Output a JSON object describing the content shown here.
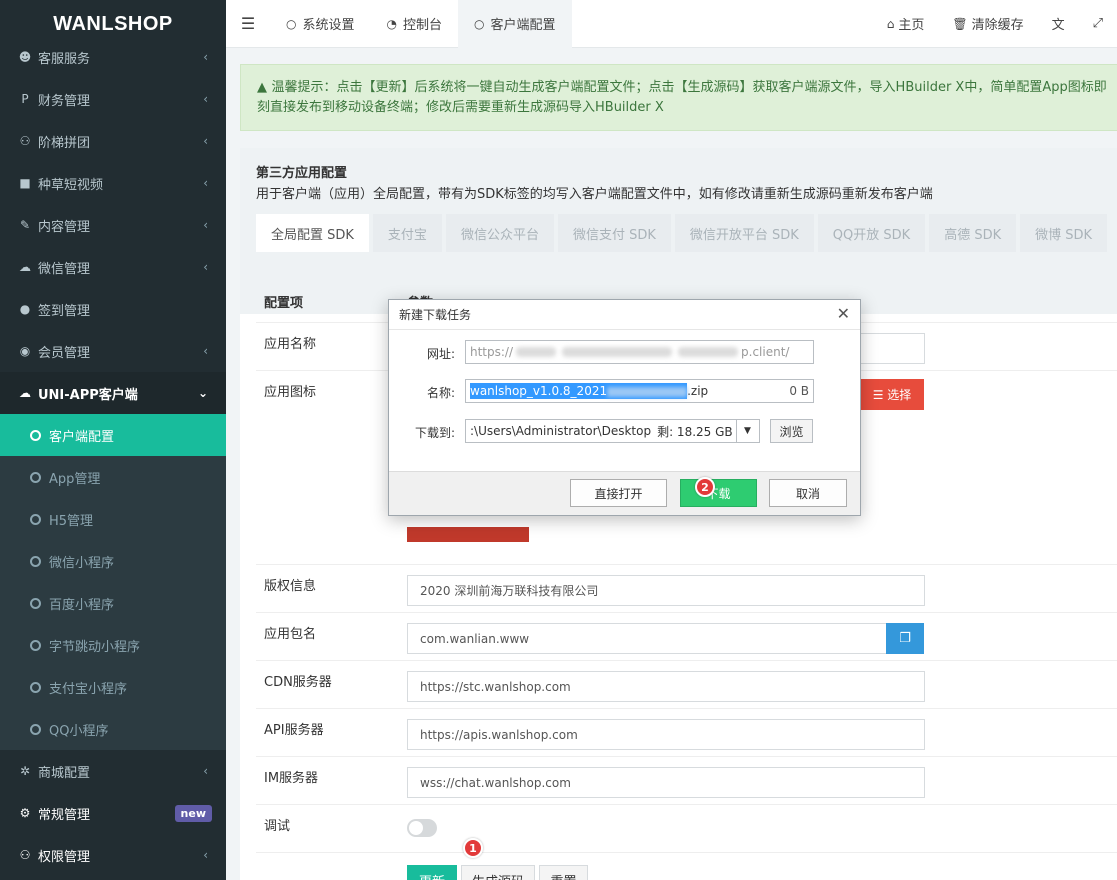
{
  "brand": "WANLSHOP",
  "sidebar": {
    "items": [
      {
        "label": "客服服务",
        "icon": "comments-icon",
        "glyph": "☻"
      },
      {
        "label": "财务管理",
        "icon": "paypal-icon",
        "glyph": "P"
      },
      {
        "label": "阶梯拼团",
        "icon": "users-icon",
        "glyph": "👥"
      },
      {
        "label": "种草短视频",
        "icon": "video-icon",
        "glyph": "■"
      },
      {
        "label": "内容管理",
        "icon": "edit-icon",
        "glyph": "✎"
      },
      {
        "label": "微信管理",
        "icon": "wechat-icon",
        "glyph": "☁"
      },
      {
        "label": "签到管理",
        "icon": "map-marker-icon",
        "glyph": "●"
      },
      {
        "label": "会员管理",
        "icon": "user-circle-icon",
        "glyph": "◉"
      }
    ],
    "open_group": {
      "label": "UNI-APP客户端",
      "icon": "cloud-icon",
      "glyph": "☁"
    },
    "sub_items": [
      "客户端配置",
      "App管理",
      "H5管理",
      "微信小程序",
      "百度小程序",
      "字节跳动小程序",
      "支付宝小程序",
      "QQ小程序"
    ],
    "after": [
      {
        "label": "商城配置",
        "icon": "gear-icon",
        "glyph": "✲"
      },
      {
        "label": "常规管理",
        "icon": "cogs-icon",
        "glyph": "⚙",
        "badge": "new"
      },
      {
        "label": "权限管理",
        "icon": "group-icon",
        "glyph": "👥"
      }
    ]
  },
  "header": {
    "tabs": [
      "系统设置",
      "控制台",
      "客户端配置"
    ],
    "home": "主页",
    "clear_cache": "清除缓存"
  },
  "alert": {
    "title": "温馨提示：",
    "text": "点击【更新】后系统将一键自动生成客户端配置文件；点击【生成源码】获取客户端源文件，导入HBuilder X中，简单配置App图标即刻直接发布到移动设备终端；修改后需要重新生成源码导入HBuilder X"
  },
  "panel": {
    "title": "第三方应用配置",
    "desc": "用于客户端（应用）全局配置，带有为SDK标签的均写入客户端配置文件中，如有修改请重新生成源码重新发布客户端",
    "tabs": [
      "全局配置 SDK",
      "支付宝",
      "微信公众平台",
      "微信支付 SDK",
      "微信开放平台 SDK",
      "QQ开放 SDK",
      "高德 SDK",
      "微博 SDK"
    ]
  },
  "table": {
    "col_item": "配置项",
    "col_param": "参数",
    "rows": {
      "app_name": "应用名称",
      "app_icon": "应用图标",
      "choose": "选择",
      "copyright": "版权信息",
      "copyright_val": "2020 深圳前海万联科技有限公司",
      "package": "应用包名",
      "package_val": "com.wanlian.www",
      "cdn": "CDN服务器",
      "cdn_val": "https://stc.wanlshop.com",
      "api": "API服务器",
      "api_val": "https://apis.wanlshop.com",
      "im": "IM服务器",
      "im_val": "wss://chat.wanlshop.com",
      "debug": "调试"
    },
    "buttons": {
      "update": "更新",
      "generate": "生成源码",
      "reset": "重置"
    }
  },
  "dialog": {
    "title": "新建下载任务",
    "url_label": "网址:",
    "url_start": "https://",
    "url_end": "p.client/",
    "name_label": "名称:",
    "name_start": "wanlshop_v1.0.8_2021",
    "name_end": ".zip",
    "size": "0 B",
    "save_label": "下载到:",
    "save_path": ":\\Users\\Administrator\\Desktop",
    "free_space": "剩: 18.25 GB",
    "browse": "浏览",
    "open_direct": "直接打开",
    "download": "下载",
    "cancel": "取消"
  },
  "markers": [
    "1",
    "2"
  ]
}
